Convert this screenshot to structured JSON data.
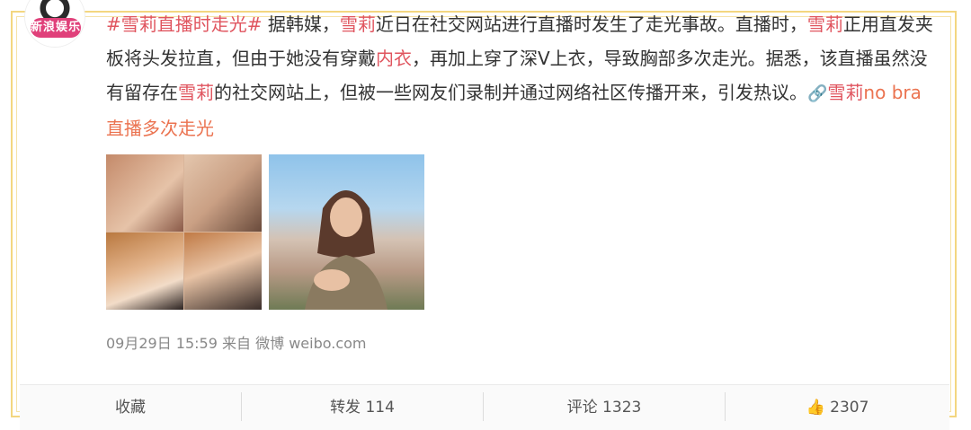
{
  "avatar": {
    "badge_text": "新浪娱乐"
  },
  "post": {
    "hashtag": "#雪莉直播时走光#",
    "seg1": " 据韩媒，",
    "name1": "雪莉",
    "seg2": "近日在社交网站进行直播时发生了走光事故。直播时，",
    "name2": "雪莉",
    "seg3": "正用直发夹板将头发拉直，但由于她没有穿戴",
    "word_red": "内衣",
    "seg4": "，再加上穿了深V上衣，导致胸部多次走光。据悉，该直播虽然没有留存在",
    "name3": "雪莉",
    "seg5": "的社交网站上，但被一些网友们录制并通过网络社区传播开来，引发热议。",
    "link_icon": "🔗",
    "link_name": "雪莉",
    "link_text": "no bra直播多次走光"
  },
  "meta": {
    "time": "09月29日 15:59",
    "source_prefix": "来自",
    "source": "微博 weibo.com"
  },
  "actions": {
    "favorite": "收藏",
    "repost": "转发 114",
    "comment": "评论 1323",
    "like_icon": "👍",
    "like_count": "2307"
  },
  "colors": {
    "accent": "#eb7350",
    "name": "#e0555f",
    "frame": "#f3d680"
  }
}
